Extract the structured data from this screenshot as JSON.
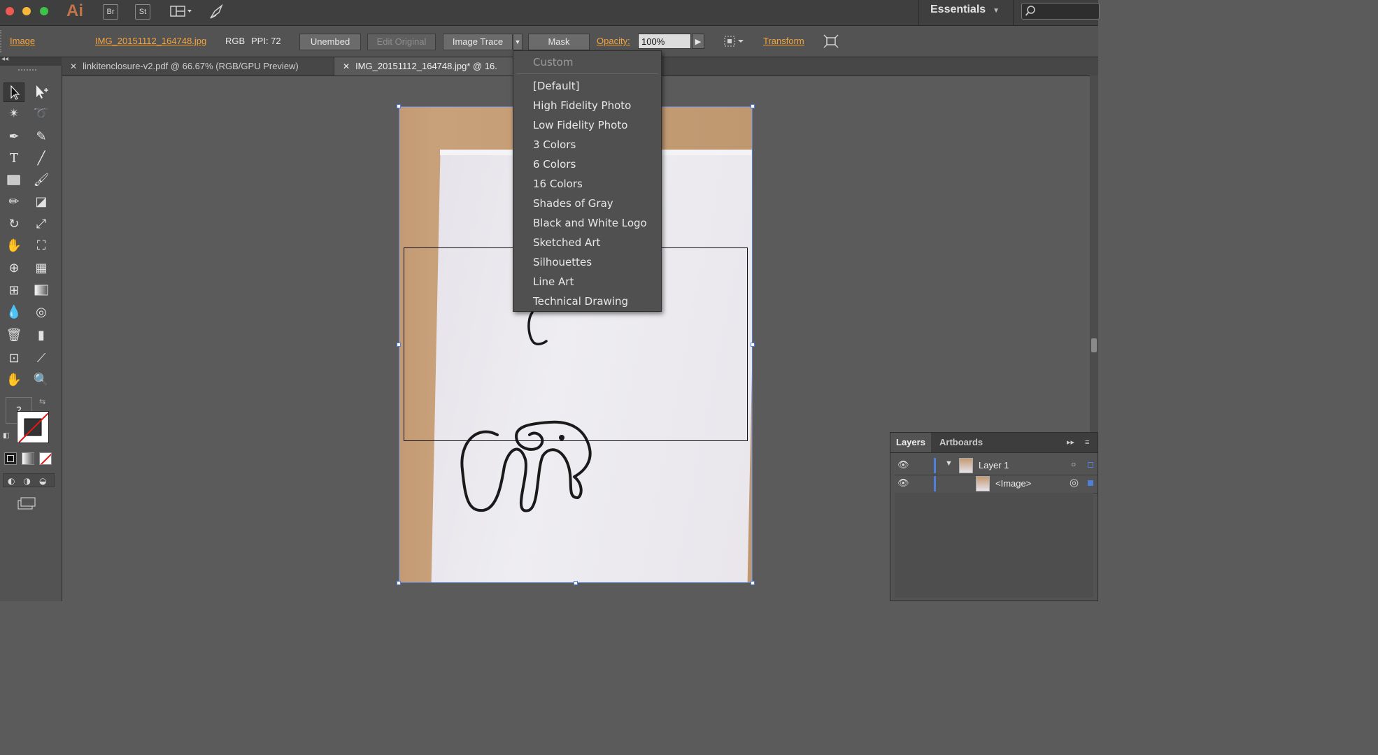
{
  "app": {
    "logo": "Ai",
    "bridge": "Br",
    "stock": "St",
    "workspace": "Essentials"
  },
  "control": {
    "object_type": "Image",
    "filename": "IMG_20151112_164748.jpg",
    "color_mode": "RGB",
    "ppi": "PPI: 72",
    "unembed": "Unembed",
    "edit_original": "Edit Original",
    "image_trace": "Image Trace",
    "mask": "Mask",
    "opacity_label": "Opacity:",
    "opacity_value": "100%",
    "transform": "Transform"
  },
  "tabs": [
    {
      "label": "linkitenclosure-v2.pdf @ 66.67% (RGB/GPU Preview)"
    },
    {
      "label": "IMG_20151112_164748.jpg* @ 16."
    }
  ],
  "trace_presets": {
    "header": "Custom",
    "items": [
      "[Default]",
      "High Fidelity Photo",
      "Low Fidelity Photo",
      "3 Colors",
      "6 Colors",
      "16 Colors",
      "Shades of Gray",
      "Black and White Logo",
      "Sketched Art",
      "Silhouettes",
      "Line Art",
      "Technical Drawing"
    ]
  },
  "layers_panel": {
    "tabs": [
      "Layers",
      "Artboards"
    ],
    "rows": [
      {
        "name": "Layer 1"
      },
      {
        "name": "<Image>"
      }
    ]
  },
  "tools": {
    "question": "?"
  },
  "colors": {
    "accent": "#f4a43a",
    "selection": "#4f7fd8",
    "logo": "#c1744a"
  }
}
